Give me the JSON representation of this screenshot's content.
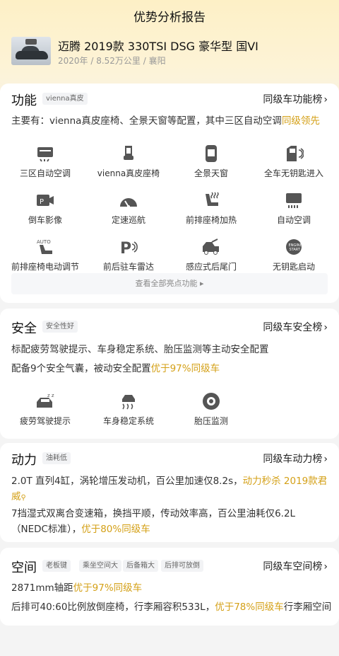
{
  "header": {
    "title": "优势分析报告"
  },
  "car": {
    "name": "迈腾 2019款 330TSI DSG 豪华型 国VI",
    "meta": "2020年 / 8.52万公里 / 襄阳"
  },
  "function": {
    "title": "功能",
    "tag": "vienna真皮",
    "rank_link": "同级车功能榜",
    "desc_prefix": "主要有：vienna真皮座椅、全景天窗等配置，其中三区自动空调",
    "desc_highlight": "同级领先",
    "features": [
      {
        "label": "三区自动空调",
        "icon": "climate-control-icon"
      },
      {
        "label": "vienna真皮座椅",
        "icon": "leather-seat-icon"
      },
      {
        "label": "全景天窗",
        "icon": "sunroof-icon"
      },
      {
        "label": "全车无钥匙进入",
        "icon": "keyless-entry-icon"
      },
      {
        "label": "倒车影像",
        "icon": "reverse-camera-icon"
      },
      {
        "label": "定速巡航",
        "icon": "cruise-control-icon"
      },
      {
        "label": "前排座椅加热",
        "icon": "seat-heating-icon"
      },
      {
        "label": "自动空调",
        "icon": "auto-ac-icon"
      },
      {
        "label": "前排座椅电动调节",
        "icon": "power-seat-icon"
      },
      {
        "label": "前后驻车雷达",
        "icon": "parking-radar-icon"
      },
      {
        "label": "感应式后尾门",
        "icon": "power-tailgate-icon"
      },
      {
        "label": "无钥匙启动",
        "icon": "start-button-icon"
      }
    ],
    "view_all": "查看全部亮点功能"
  },
  "safety": {
    "title": "安全",
    "tag": "安全性好",
    "rank_link": "同级车安全榜",
    "line1": "标配疲劳驾驶提示、车身稳定系统、胎压监测等主动安全配置",
    "line2_prefix": "配备9个安全气囊，被动安全配置",
    "line2_highlight": "优于97%同级车",
    "features": [
      {
        "label": "疲劳驾驶提示",
        "icon": "fatigue-alert-icon"
      },
      {
        "label": "车身稳定系统",
        "icon": "stability-control-icon"
      },
      {
        "label": "胎压监测",
        "icon": "tire-pressure-icon"
      }
    ]
  },
  "power": {
    "title": "动力",
    "tag": "油耗低",
    "rank_link": "同级车动力榜",
    "line1_prefix": "2.0T 直列4缸，涡轮增压发动机，百公里加速仅8.2s，",
    "line1_highlight": "动力秒杀 2019款君威",
    "line2_prefix": "7挡湿式双离合变速箱，换挡平顺，传动效率高，百公里油耗仅6.2L（NEDC标准），",
    "line2_highlight": "优于80%同级车"
  },
  "space": {
    "title": "空间",
    "tags": [
      "老板键",
      "乘坐空间大",
      "后备箱大",
      "后排可放倒"
    ],
    "rank_link": "同级车空间榜",
    "line1_prefix": "2871mm轴距",
    "line1_highlight": "优于97%同级车",
    "line2_prefix": "后排可40:60比例放倒座椅，行李厢容积533L，",
    "line2_highlight": "优于78%同级车",
    "line2_suffix": "行李厢空间"
  },
  "colors": {
    "highlight": "#d4a017",
    "accent_bg": "#fdf0c6"
  }
}
